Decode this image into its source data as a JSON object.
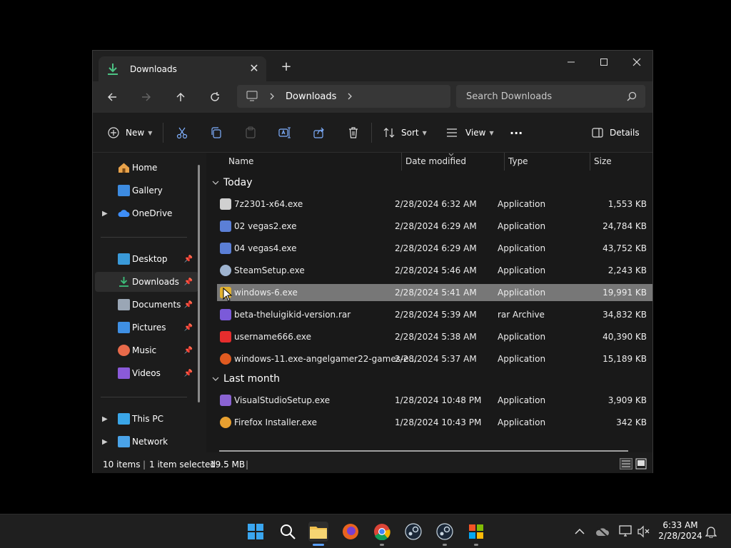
{
  "window": {
    "tab_title": "Downloads",
    "new_tab_label": "+",
    "controls": [
      "minimize",
      "maximize",
      "close"
    ]
  },
  "navbar": {
    "breadcrumb": "Downloads",
    "search_placeholder": "Search Downloads"
  },
  "commandbar": {
    "new_label": "New",
    "sort_label": "Sort",
    "view_label": "View",
    "more_label": "···",
    "details_label": "Details"
  },
  "sidebar": {
    "quick": [
      {
        "label": "Home",
        "icon": "home-icon",
        "color": "#e8a24a"
      },
      {
        "label": "Gallery",
        "icon": "gallery-icon",
        "color": "#3d8be0"
      },
      {
        "label": "OneDrive",
        "icon": "cloud-icon",
        "color": "#3e8ef7",
        "expandable": true
      }
    ],
    "pinned": [
      {
        "label": "Desktop",
        "icon": "desktop-icon",
        "color": "#3a9ad9"
      },
      {
        "label": "Downloads",
        "icon": "download-icon",
        "color": "#3cbf7a",
        "selected": true
      },
      {
        "label": "Documents",
        "icon": "documents-icon",
        "color": "#9aa6b5"
      },
      {
        "label": "Pictures",
        "icon": "pictures-icon",
        "color": "#3f8fe3"
      },
      {
        "label": "Music",
        "icon": "music-icon",
        "color": "#e86a4a"
      },
      {
        "label": "Videos",
        "icon": "videos-icon",
        "color": "#8a5ad9"
      }
    ],
    "devices": [
      {
        "label": "This PC",
        "icon": "pc-icon",
        "color": "#3aa6e8",
        "expandable": true
      },
      {
        "label": "Network",
        "icon": "network-icon",
        "color": "#4aa3e8",
        "expandable": true
      }
    ]
  },
  "columns": {
    "name": "Name",
    "date": "Date modified",
    "type": "Type",
    "size": "Size"
  },
  "groups": [
    {
      "label": "Today",
      "rows": [
        {
          "name": "7z2301-x64.exe",
          "date": "2/28/2024 6:32 AM",
          "type": "Application",
          "size": "1,553 KB",
          "icon_color": "#d0d0d0"
        },
        {
          "name": "02 vegas2.exe",
          "date": "2/28/2024 6:29 AM",
          "type": "Application",
          "size": "24,784 KB",
          "icon_color": "#5b7fd6"
        },
        {
          "name": "04 vegas4.exe",
          "date": "2/28/2024 6:29 AM",
          "type": "Application",
          "size": "43,752 KB",
          "icon_color": "#5b7fd6"
        },
        {
          "name": "SteamSetup.exe",
          "date": "2/28/2024 5:46 AM",
          "type": "Application",
          "size": "2,243 KB",
          "icon_color": "#9fb4d0"
        },
        {
          "name": "windows-6.exe",
          "date": "2/28/2024 5:41 AM",
          "type": "Application",
          "size": "19,991 KB",
          "icon_color": "#e1b230",
          "selected": true
        },
        {
          "name": "beta-theluigikid-version.rar",
          "date": "2/28/2024 5:39 AM",
          "type": "rar Archive",
          "size": "34,832 KB",
          "icon_color": "#7b5ad9"
        },
        {
          "name": "username666.exe",
          "date": "2/28/2024 5:38 AM",
          "type": "Application",
          "size": "40,390 KB",
          "icon_color": "#e62d2d"
        },
        {
          "name": "windows-11.exe-angelgamer22-games-e...",
          "date": "2/28/2024 5:37 AM",
          "type": "Application",
          "size": "15,189 KB",
          "icon_color": "#e05a20"
        }
      ]
    },
    {
      "label": "Last month",
      "rows": [
        {
          "name": "VisualStudioSetup.exe",
          "date": "1/28/2024 10:48 PM",
          "type": "Application",
          "size": "3,909 KB",
          "icon_color": "#8a63d2"
        },
        {
          "name": "Firefox Installer.exe",
          "date": "1/28/2024 10:43 PM",
          "type": "Application",
          "size": "342 KB",
          "icon_color": "#e8a030"
        }
      ]
    }
  ],
  "status": {
    "count": "10 items",
    "selection": "1 item selected",
    "size": "19.5 MB"
  },
  "taskbar": {
    "apps": [
      "start-icon",
      "search-icon",
      "file-explorer-icon",
      "firefox-icon",
      "chrome-icon",
      "steam-icon",
      "steam-icon",
      "windows-xp-icon"
    ],
    "time": "6:33 AM",
    "date": "2/28/2024"
  }
}
